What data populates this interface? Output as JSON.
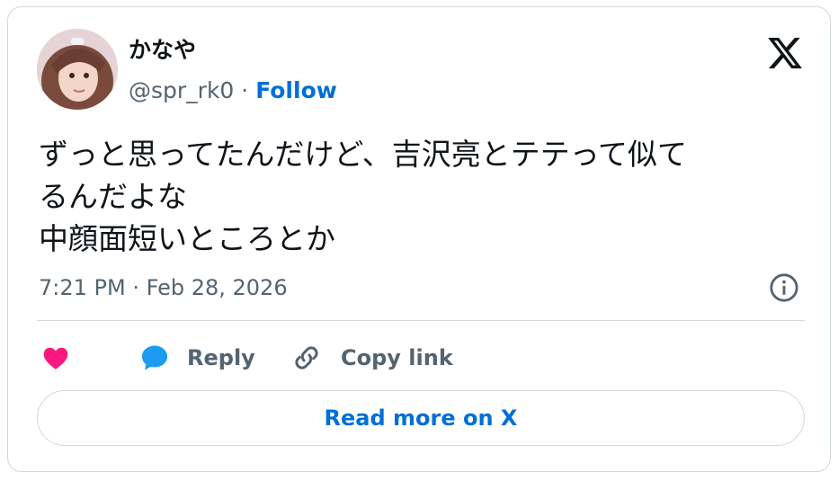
{
  "author": {
    "display_name": "かなや",
    "handle": "@spr_rk0",
    "separator": " · ",
    "follow_label": "Follow"
  },
  "tweet": {
    "lines": [
      "ずっと思ってたんだけど、吉沢亮とテテって似て",
      "るんだよな",
      "中顔面短いところとか"
    ],
    "timestamp": "7:21 PM · Feb 28, 2026"
  },
  "actions": {
    "reply_label": "Reply",
    "copy_link_label": "Copy link",
    "read_more_label": "Read more on X"
  },
  "colors": {
    "heart": "#f91880",
    "reply": "#1d9bf0",
    "link_blue": "#006fd6",
    "muted": "#536471",
    "border": "#cfd9de"
  },
  "icons": [
    "x-logo-icon",
    "info-icon",
    "heart-icon",
    "reply-bubble-icon",
    "link-icon"
  ]
}
